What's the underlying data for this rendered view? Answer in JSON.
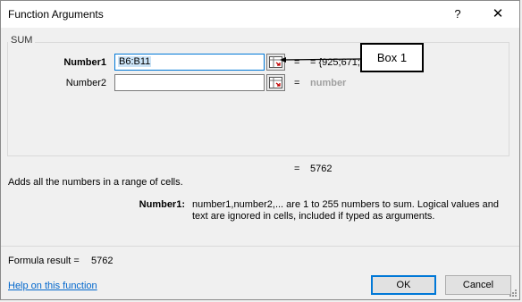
{
  "window": {
    "title": "Function Arguments",
    "help_glyph": "?",
    "close_glyph": "✕"
  },
  "function_group": {
    "name": "SUM"
  },
  "arguments": [
    {
      "label": "Number1",
      "value": "B6:B11",
      "result": "= {925;671;12",
      "bold": true
    },
    {
      "label": "Number2",
      "value": "",
      "result": "number",
      "bold": false
    }
  ],
  "annotation": {
    "callout_text": "Box 1"
  },
  "result": {
    "equals": "=",
    "value": "5762"
  },
  "description": "Adds all the numbers in a range of cells.",
  "argument_help": {
    "label": "Number1:",
    "text": "number1,number2,... are 1 to 255 numbers to sum. Logical values and text are ignored in cells, included if typed as arguments."
  },
  "formula_result": {
    "label": "Formula result =",
    "value": "5762"
  },
  "footer": {
    "help_link": "Help on this function",
    "ok_label": "OK",
    "cancel_label": "Cancel"
  },
  "icons": {
    "ref_button": "range-select-icon",
    "resize": "resize-grip-icon"
  }
}
